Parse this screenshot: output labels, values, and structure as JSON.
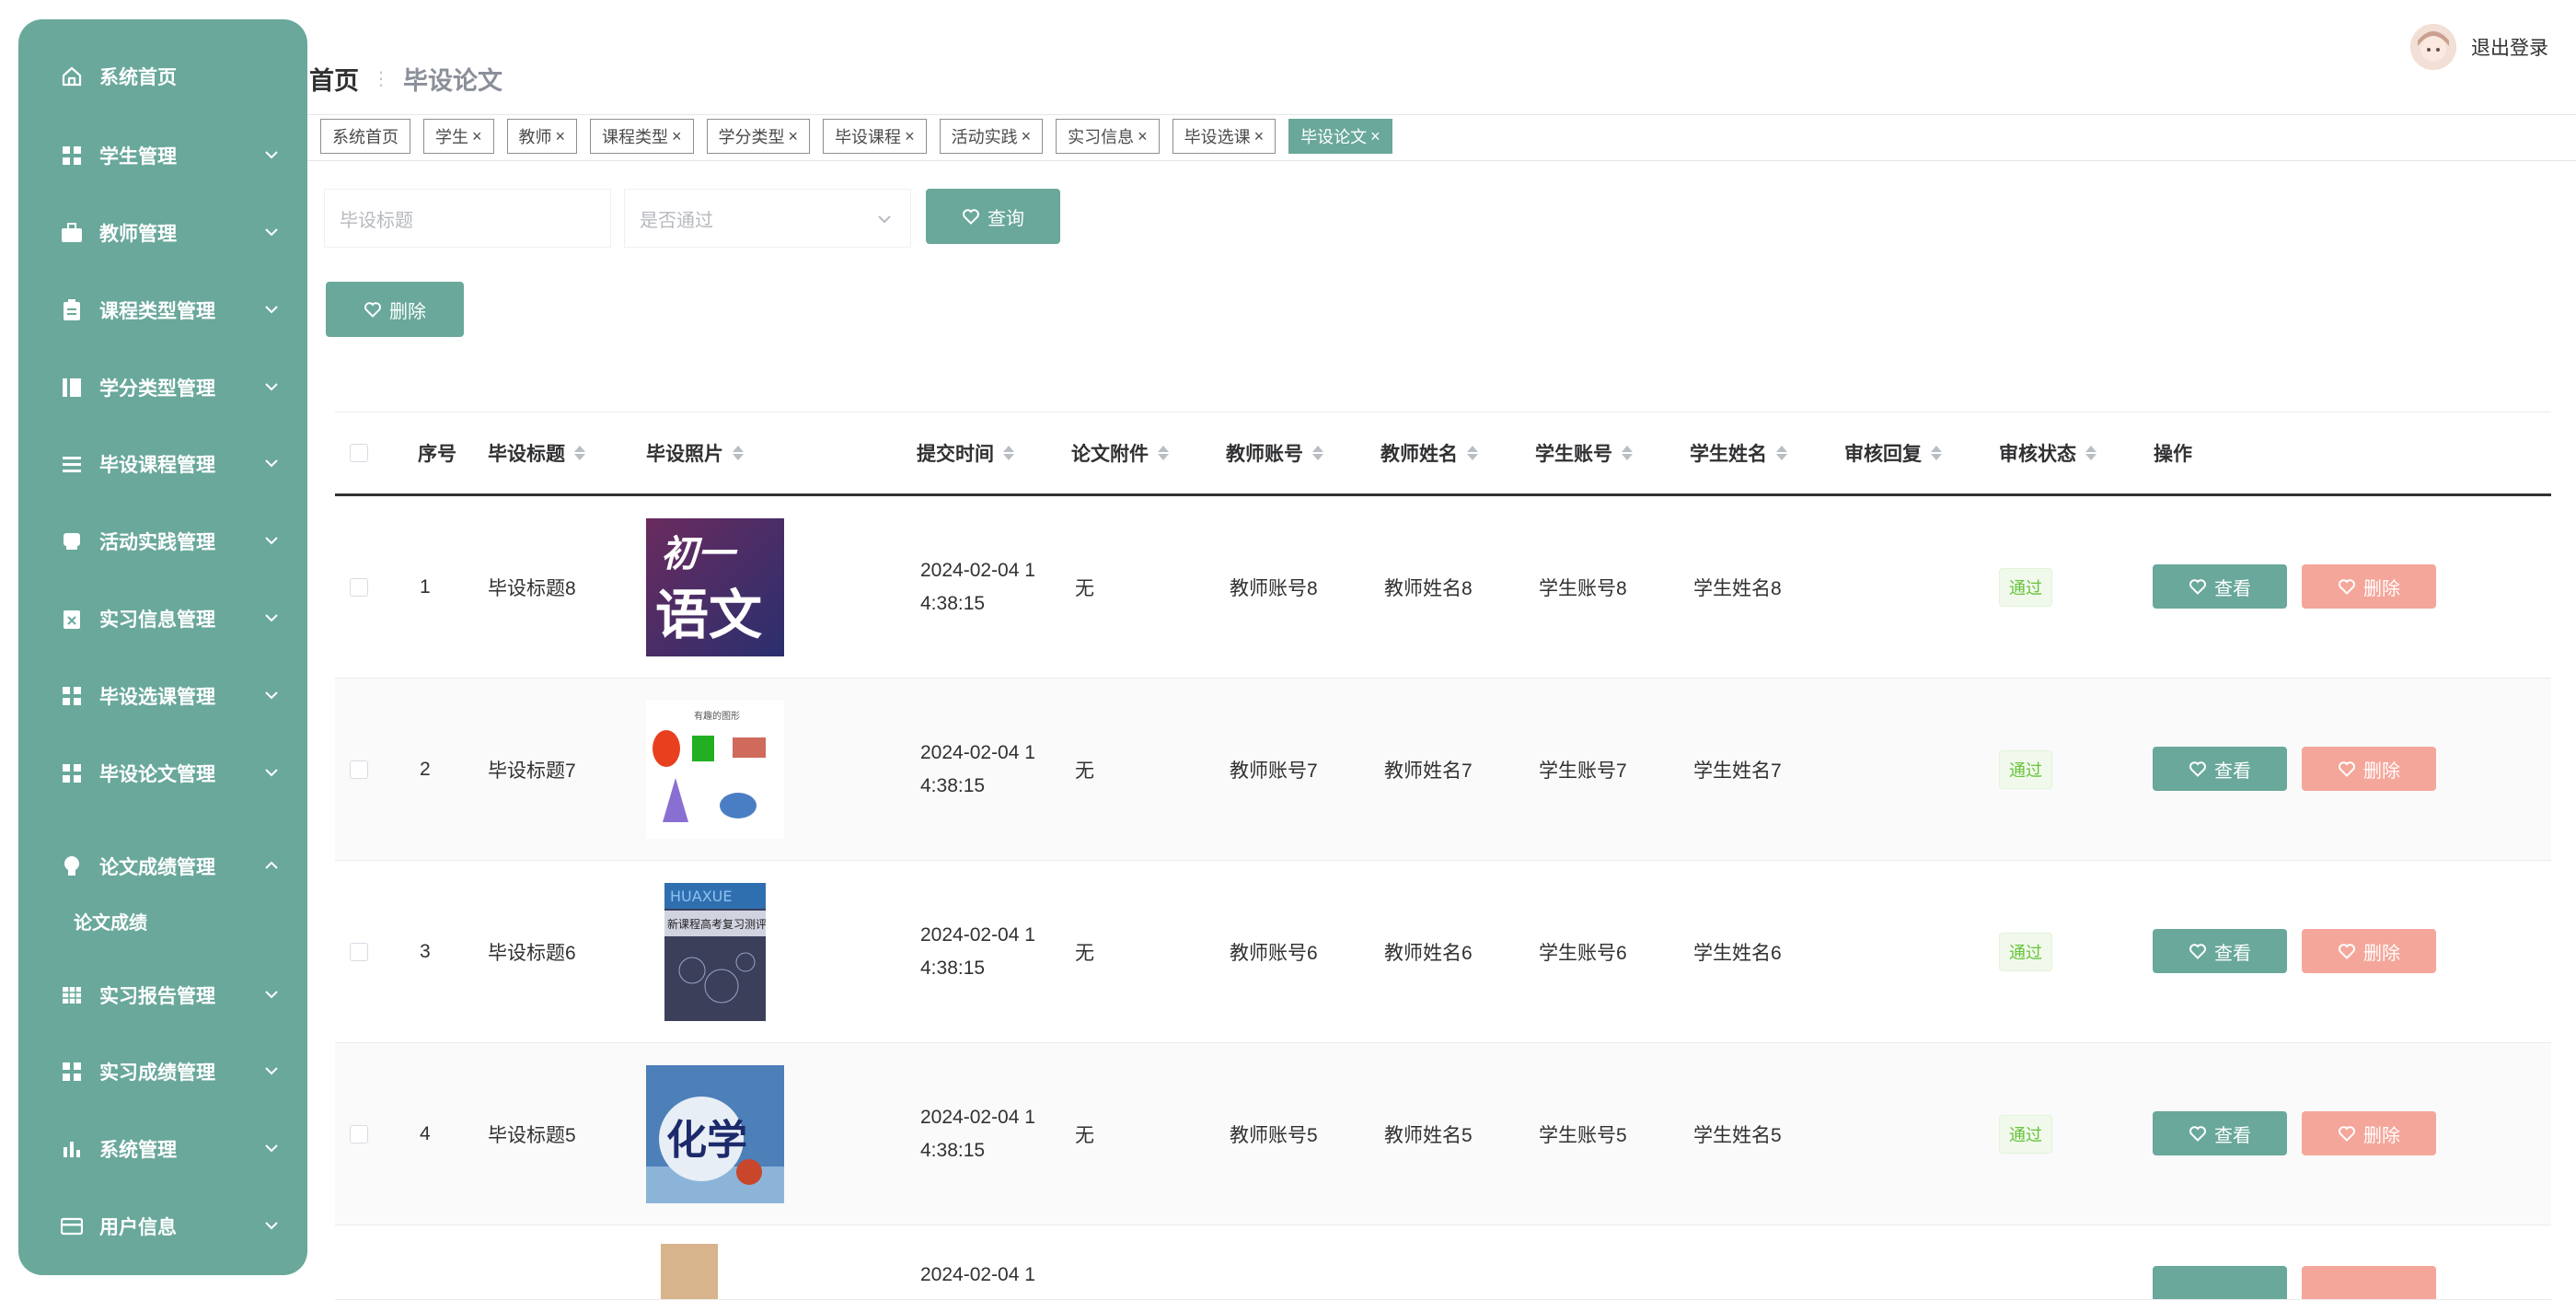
{
  "sidebar": {
    "items": [
      {
        "label": "系统首页",
        "icon": "home-icon"
      },
      {
        "label": "学生管理",
        "icon": "grid-icon"
      },
      {
        "label": "教师管理",
        "icon": "briefcase-icon"
      },
      {
        "label": "课程类型管理",
        "icon": "clipboard-icon"
      },
      {
        "label": "学分类型管理",
        "icon": "book-icon"
      },
      {
        "label": "毕设课程管理",
        "icon": "list-icon"
      },
      {
        "label": "活动实践管理",
        "icon": "printer-icon"
      },
      {
        "label": "实习信息管理",
        "icon": "clipboard-x-icon"
      },
      {
        "label": "毕设选课管理",
        "icon": "grid-icon"
      },
      {
        "label": "毕设论文管理",
        "icon": "grid-icon"
      },
      {
        "label": "论文成绩管理",
        "icon": "bulb-icon"
      },
      {
        "label": "实习报告管理",
        "icon": "table-icon"
      },
      {
        "label": "实习成绩管理",
        "icon": "grid-icon"
      },
      {
        "label": "系统管理",
        "icon": "bar-chart-icon"
      },
      {
        "label": "用户信息",
        "icon": "card-icon"
      }
    ],
    "submenu_label": "论文成绩"
  },
  "header": {
    "breadcrumb_home": "首页",
    "breadcrumb_current": "毕设论文",
    "logout": "退出登录"
  },
  "tags": [
    "系统首页",
    "学生",
    "教师",
    "课程类型",
    "学分类型",
    "毕设课程",
    "活动实践",
    "实习信息",
    "毕设选课",
    "毕设论文"
  ],
  "search": {
    "title_placeholder": "毕设标题",
    "pass_placeholder": "是否通过",
    "query_label": "查询",
    "delete_label": "删除"
  },
  "table": {
    "columns": [
      "序号",
      "毕设标题",
      "毕设照片",
      "提交时间",
      "论文附件",
      "教师账号",
      "教师姓名",
      "学生账号",
      "学生姓名",
      "审核回复",
      "审核状态",
      "操作"
    ],
    "rows": [
      {
        "index": "1",
        "title": "毕设标题8",
        "time1": "2024-02-04 1",
        "time2": "4:38:15",
        "attachment": "无",
        "teacher_account": "教师账号8",
        "teacher_name": "教师姓名8",
        "student_account": "学生账号8",
        "student_name": "学生姓名8",
        "reply": "",
        "status": "通过",
        "photo": "chinese-book-cover"
      },
      {
        "index": "2",
        "title": "毕设标题7",
        "time1": "2024-02-04 1",
        "time2": "4:38:15",
        "attachment": "无",
        "teacher_account": "教师账号7",
        "teacher_name": "教师姓名7",
        "student_account": "学生账号7",
        "student_name": "学生姓名7",
        "reply": "",
        "status": "通过",
        "photo": "shapes-image"
      },
      {
        "index": "3",
        "title": "毕设标题6",
        "time1": "2024-02-04 1",
        "time2": "4:38:15",
        "attachment": "无",
        "teacher_account": "教师账号6",
        "teacher_name": "教师姓名6",
        "student_account": "学生账号6",
        "student_name": "学生姓名6",
        "reply": "",
        "status": "通过",
        "photo": "review-book-cover"
      },
      {
        "index": "4",
        "title": "毕设标题5",
        "time1": "2024-02-04 1",
        "time2": "4:38:15",
        "attachment": "无",
        "teacher_account": "教师账号5",
        "teacher_name": "教师姓名5",
        "student_account": "学生账号5",
        "student_name": "学生姓名5",
        "reply": "",
        "status": "通过",
        "photo": "chemistry-book-cover"
      }
    ],
    "view_label": "查看",
    "delete_label": "删除",
    "partial_row_time": "2024-02-04 1"
  },
  "cover_text": {
    "chinese_top": "初一",
    "chinese_bottom": "语文",
    "shapes_title": "有趣的图形",
    "review_top": "HUAXUE",
    "review_title": "新课程高考复习测评",
    "chemistry": "化学"
  },
  "colors": {
    "accent": "#69a89b",
    "danger": "#f5a69a",
    "success": "#67c23a"
  }
}
